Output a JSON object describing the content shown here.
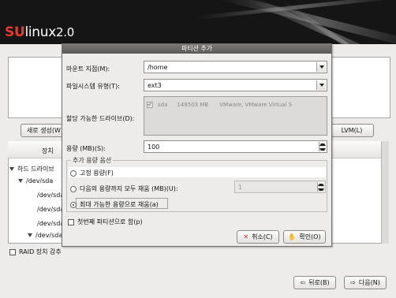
{
  "header": {
    "logo_su": "SU",
    "logo_linux": "linux",
    "logo_version": "2.0"
  },
  "background": {
    "new_button": "새로 생성(W)",
    "lvm_button": "LVM(L)",
    "tree_header_device": "장치",
    "tree_rows": [
      "하드 드라이브",
      "/dev/sda",
      "/dev/sda",
      "/dev/sda",
      "/dev/sda",
      "/dev/sda"
    ],
    "raid_label": "RAID 장치 감추",
    "back_button": "뒤로(B)",
    "next_button": "다음(N)"
  },
  "dialog": {
    "title": "파티션 추가",
    "mount_label": "마운트 지점(M):",
    "mount_value": "/home",
    "fs_label": "파일시스템 유형(T):",
    "fs_value": "ext3",
    "drives_label": "할당 가능한 드라이브(D):",
    "drive": {
      "name": "sda",
      "size": "149503 MB",
      "model": "VMware, VMware Virtual S",
      "checked": true
    },
    "size_label": "용량 (MB)(S):",
    "size_value": "100",
    "options_legend": "추가 용량 옵션",
    "opt_fixed": "고정 용량(F)",
    "opt_fill_upto": "다음의 용량까지 모두 채움 (MB)(U):",
    "opt_fill_upto_value": "1",
    "opt_fill_max": "최대 가능한 용량으로 채움(a)",
    "primary_label": "첫번째 파티션으로 함(p)",
    "cancel_button": "취소(C)",
    "ok_button": "확인(O)"
  },
  "colors": {
    "logo_accent": "#e23b2a",
    "banner": "#151515",
    "dialog_title": "#666561"
  },
  "icons": [
    "chevron-down-icon",
    "spin-up-icon",
    "spin-down-icon",
    "cancel-x-icon",
    "ok-icon",
    "back-arrow-icon",
    "next-arrow-icon"
  ]
}
